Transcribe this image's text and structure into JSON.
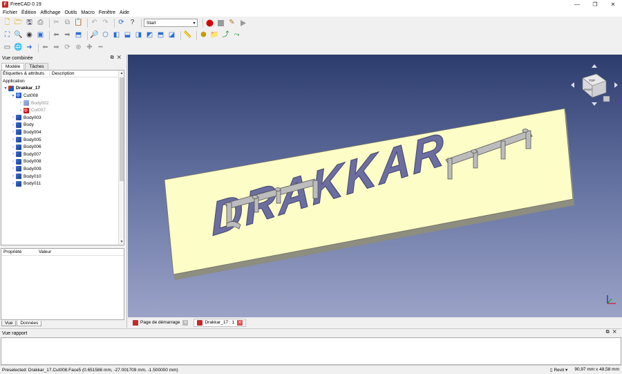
{
  "window": {
    "title": "FreeCAD 0.19",
    "icon": "freecad-logo-icon"
  },
  "menu": [
    "Fichier",
    "Édition",
    "Affichage",
    "Outils",
    "Macro",
    "Fenêtre",
    "Aide"
  ],
  "toolbar": {
    "workbench_value": "Start"
  },
  "combo_view": {
    "title": "Vue combinée",
    "tabs": [
      "Modèle",
      "Tâches"
    ],
    "tree_columns": [
      "Étiquettes & attributs",
      "Description"
    ],
    "tree_root": "Application",
    "tree": [
      {
        "label": "Drakkar_17",
        "indent": 0,
        "arrow": "▾",
        "icon": "document",
        "style": "bold"
      },
      {
        "label": "Cut008",
        "indent": 1,
        "arrow": "▾",
        "icon": "cut",
        "style": ""
      },
      {
        "label": "Body002",
        "indent": 2,
        "arrow": "›",
        "icon": "body-dim",
        "style": "dim"
      },
      {
        "label": "Cut007",
        "indent": 2,
        "arrow": "›",
        "icon": "cut-err",
        "style": "dim"
      },
      {
        "label": "Body003",
        "indent": 1,
        "arrow": "›",
        "icon": "body",
        "style": ""
      },
      {
        "label": "Body",
        "indent": 1,
        "arrow": "›",
        "icon": "body",
        "style": ""
      },
      {
        "label": "Body004",
        "indent": 1,
        "arrow": "›",
        "icon": "body",
        "style": ""
      },
      {
        "label": "Body005",
        "indent": 1,
        "arrow": "›",
        "icon": "body",
        "style": ""
      },
      {
        "label": "Body006",
        "indent": 1,
        "arrow": "›",
        "icon": "body",
        "style": ""
      },
      {
        "label": "Body007",
        "indent": 1,
        "arrow": "›",
        "icon": "body",
        "style": ""
      },
      {
        "label": "Body008",
        "indent": 1,
        "arrow": "›",
        "icon": "body",
        "style": ""
      },
      {
        "label": "Body009",
        "indent": 1,
        "arrow": "›",
        "icon": "body",
        "style": ""
      },
      {
        "label": "Body010",
        "indent": 1,
        "arrow": "›",
        "icon": "body",
        "style": ""
      },
      {
        "label": "Body011",
        "indent": 1,
        "arrow": "›",
        "icon": "body",
        "style": ""
      }
    ],
    "prop_columns": [
      "Propriété",
      "Valeur"
    ],
    "bottom_tabs": [
      "Vue",
      "Données"
    ]
  },
  "viewport": {
    "model_text": "DRAKKAR",
    "navcube_top": "TOP",
    "navcube_front": "FRONT",
    "plate_color": "#fdfdc8",
    "background_top": "#2c3c6c",
    "background_bottom": "#9ba3c7"
  },
  "doc_tabs": [
    "Page de démarrage",
    "Drakkar_17 : 1"
  ],
  "report": {
    "title": "Vue rapport"
  },
  "status": {
    "message": "Preselected: Drakkar_17.Cut008.Face5 (0.651586 mm, -27.001709 mm, -1.500000 mm)",
    "nav_style": "Revit",
    "dimensions": "90,97 mm x 48,58 mm"
  }
}
